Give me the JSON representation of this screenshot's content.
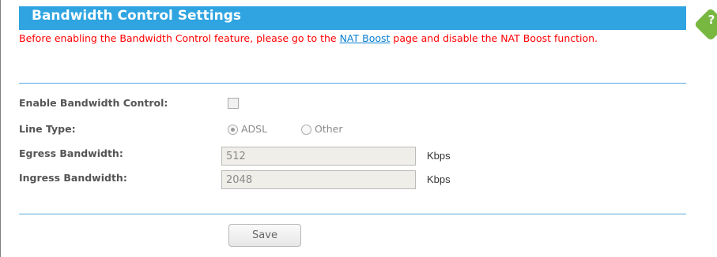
{
  "header": {
    "title": "Bandwidth Control Settings"
  },
  "help": {
    "icon": "help-icon",
    "label": "?"
  },
  "notice": {
    "before": "Before enabling the Bandwidth Control feature, please go to the ",
    "link": "NAT Boost",
    "after": " page and disable the NAT Boost function."
  },
  "form": {
    "enable_label": "Enable Bandwidth Control:",
    "enable_checked": false,
    "line_type_label": "Line Type:",
    "line_type_options": [
      "ADSL",
      "Other"
    ],
    "line_type_selected": "ADSL",
    "egress_label": "Egress Bandwidth:",
    "egress_value": "512",
    "egress_unit": "Kbps",
    "ingress_label": "Ingress Bandwidth:",
    "ingress_value": "2048",
    "ingress_unit": "Kbps"
  },
  "actions": {
    "save_label": "Save"
  },
  "colors": {
    "accent": "#2fa4e1",
    "notice": "#ff0000",
    "link": "#0a7fd1",
    "help": "#78b740"
  }
}
